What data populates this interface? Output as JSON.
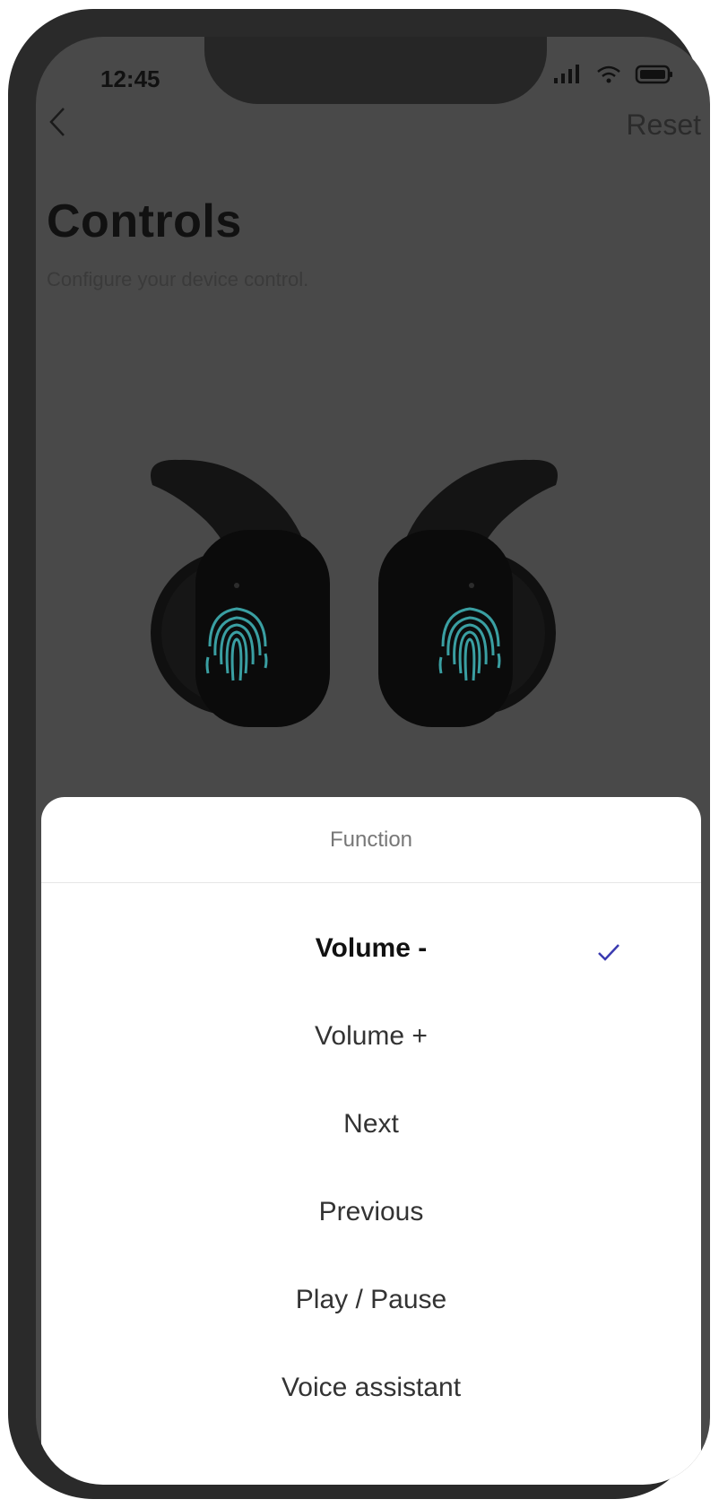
{
  "status_bar": {
    "time": "12:45",
    "icons": [
      "signal-icon",
      "wifi-icon",
      "battery-icon"
    ]
  },
  "nav": {
    "back_icon": "chevron-left-icon",
    "reset_label": "Reset"
  },
  "page": {
    "title": "Controls",
    "subtitle": "Configure your device control."
  },
  "sheet": {
    "title": "Function",
    "options": [
      {
        "label": "Volume -",
        "selected": true
      },
      {
        "label": "Volume +",
        "selected": false
      },
      {
        "label": "Next",
        "selected": false
      },
      {
        "label": "Previous",
        "selected": false
      },
      {
        "label": "Play / Pause",
        "selected": false
      },
      {
        "label": "Voice assistant",
        "selected": false
      }
    ],
    "check_icon": "checkmark-icon"
  },
  "colors": {
    "overlay": "#494949",
    "frame": "#2a2a2a",
    "sheet": "#ffffff",
    "accent_check": "#3a3ab0",
    "fingerprint": "#3a9fa2"
  }
}
